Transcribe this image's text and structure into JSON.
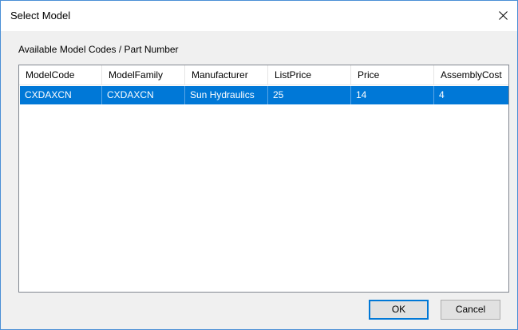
{
  "window": {
    "title": "Select Model"
  },
  "group_label": "Available Model Codes / Part Number",
  "list": {
    "columns": [
      "ModelCode",
      "ModelFamily",
      "Manufacturer",
      "ListPrice",
      "Price",
      "AssemblyCost"
    ],
    "rows": [
      {
        "selected": true,
        "cells": [
          "CXDAXCN",
          "CXDAXCN",
          "Sun Hydraulics",
          "25",
          "14",
          "4"
        ]
      }
    ]
  },
  "buttons": {
    "ok_label": "OK",
    "cancel_label": "Cancel"
  },
  "colors": {
    "selection": "#0078d7",
    "window_border": "#4a8fd6",
    "dialog_bg": "#f0f0f0"
  },
  "icons": {
    "close": "close-icon"
  }
}
